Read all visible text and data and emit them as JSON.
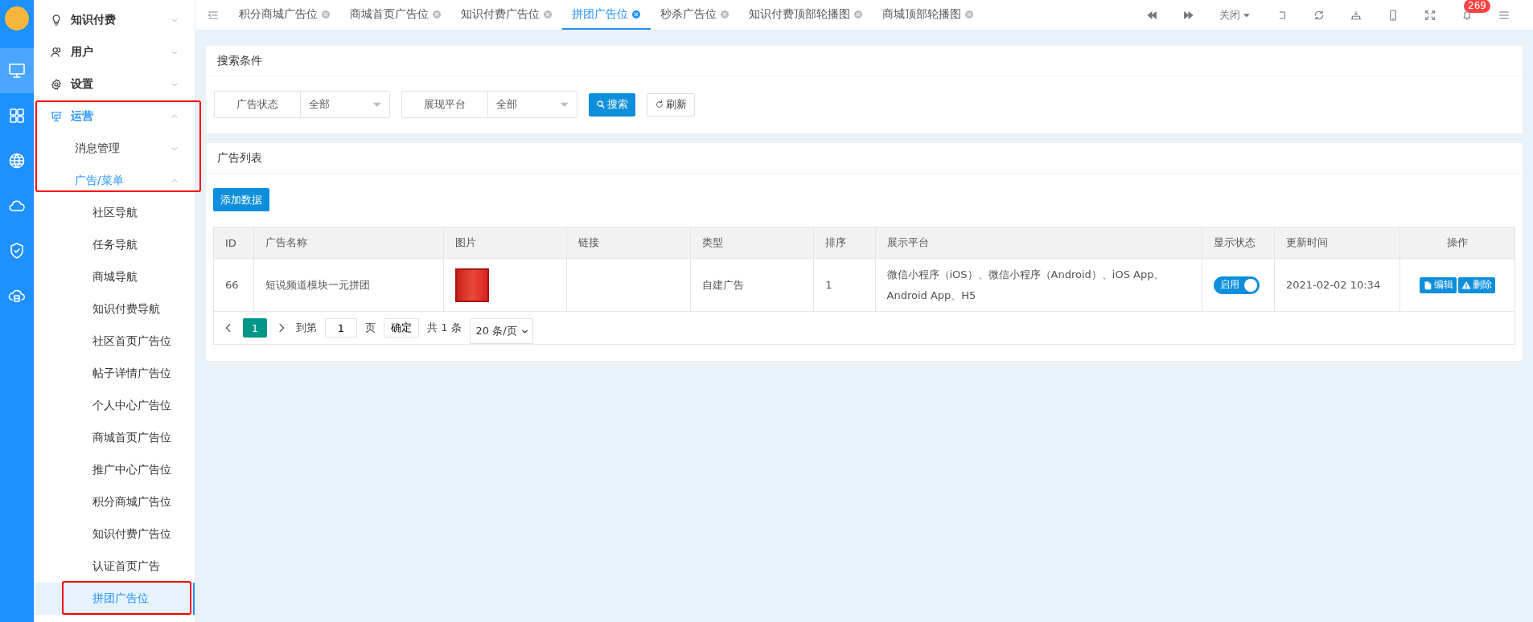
{
  "rail": {
    "items": [
      {
        "kind": "monitor",
        "selected": true
      },
      {
        "kind": "grid",
        "selected": false
      },
      {
        "kind": "globe",
        "selected": false
      },
      {
        "kind": "cloud",
        "selected": false
      },
      {
        "kind": "shield",
        "selected": false
      },
      {
        "kind": "cloudbox",
        "selected": false
      }
    ]
  },
  "sidebar": {
    "items": [
      {
        "label": "知识付费",
        "kind": "bulb",
        "expanded": false,
        "selected": false,
        "annotated": false
      },
      {
        "label": "用户",
        "kind": "users",
        "expanded": false,
        "selected": false,
        "annotated": false
      },
      {
        "label": "设置",
        "kind": "gear",
        "expanded": false,
        "selected": false,
        "annotated": false
      },
      {
        "label": "运营",
        "kind": "presentation",
        "expanded": true,
        "selected": true,
        "annotated": true,
        "children": [
          {
            "label": "消息管理",
            "expanded": false,
            "selected": false,
            "annotated": true
          },
          {
            "label": "广告/菜单",
            "expanded": true,
            "selected": true,
            "annotated": true,
            "children": [
              {
                "label": "社区导航",
                "selected": false,
                "annotated": false
              },
              {
                "label": "任务导航",
                "selected": false,
                "annotated": false
              },
              {
                "label": "商城导航",
                "selected": false,
                "annotated": false
              },
              {
                "label": "知识付费导航",
                "selected": false,
                "annotated": false
              },
              {
                "label": "社区首页广告位",
                "selected": false,
                "annotated": false
              },
              {
                "label": "帖子详情广告位",
                "selected": false,
                "annotated": false
              },
              {
                "label": "个人中心广告位",
                "selected": false,
                "annotated": false
              },
              {
                "label": "商城首页广告位",
                "selected": false,
                "annotated": false
              },
              {
                "label": "推广中心广告位",
                "selected": false,
                "annotated": false
              },
              {
                "label": "积分商城广告位",
                "selected": false,
                "annotated": false
              },
              {
                "label": "知识付费广告位",
                "selected": false,
                "annotated": false
              },
              {
                "label": "认证首页广告",
                "selected": false,
                "annotated": false
              },
              {
                "label": "拼团广告位",
                "selected": true,
                "annotated": true
              }
            ]
          }
        ]
      }
    ]
  },
  "tabs": [
    {
      "label": "积分商城广告位",
      "selected": false
    },
    {
      "label": "商城首页广告位",
      "selected": false
    },
    {
      "label": "知识付费广告位",
      "selected": false
    },
    {
      "label": "拼团广告位",
      "selected": true
    },
    {
      "label": "秒杀广告位",
      "selected": false
    },
    {
      "label": "知识付费顶部轮播图",
      "selected": false
    },
    {
      "label": "商城顶部轮播图",
      "selected": false
    }
  ],
  "toolbar": {
    "close_label": "关闭",
    "badge": "269"
  },
  "search_panel": {
    "title": "搜索条件",
    "filters": [
      {
        "label": "广告状态",
        "value": "全部"
      },
      {
        "label": "展现平台",
        "value": "全部"
      }
    ],
    "search_button": "搜索",
    "refresh_button": "刷新"
  },
  "list_panel": {
    "title": "广告列表",
    "add_button": "添加数据",
    "table": {
      "columns": [
        "ID",
        "广告名称",
        "图片",
        "链接",
        "类型",
        "排序",
        "展示平台",
        "显示状态",
        "更新时间",
        "操作"
      ],
      "rows": [
        {
          "id": "66",
          "name": "短说频道模块一元拼团",
          "type": "自建广告",
          "order": "1",
          "platforms": "微信小程序（iOS）、微信小程序（Android）、iOS App、Android App、H5",
          "status_label": "启用",
          "on": true,
          "updated": "2021-02-02 10:34",
          "edit": "编辑",
          "delete": "删除"
        }
      ]
    },
    "pagination": {
      "pages": [
        {
          "label": "1",
          "selected": true
        }
      ],
      "goto_label": "到第",
      "page_input": "1",
      "page_suffix": "页",
      "confirm": "确定",
      "total": "共 1 条",
      "page_size": "20 条/页"
    }
  }
}
